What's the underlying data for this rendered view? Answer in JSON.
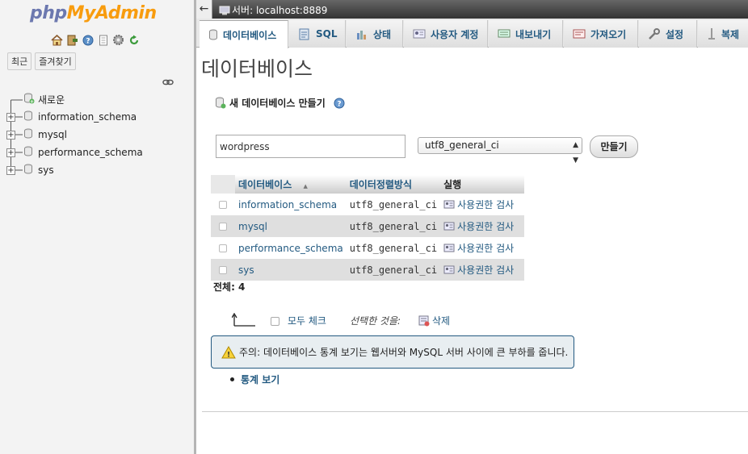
{
  "sidebar": {
    "logo_php": "php",
    "logo_myadmin": "MyAdmin",
    "icons": [
      "home-icon",
      "logout-icon",
      "help-icon",
      "docs-icon",
      "settings-icon",
      "reload-icon"
    ],
    "buttons": {
      "recent": "최근",
      "favorites": "즐겨찾기"
    },
    "tree": {
      "new_label": "새로운",
      "databases": [
        "information_schema",
        "mysql",
        "performance_schema",
        "sys"
      ]
    }
  },
  "topbar": {
    "back": "←",
    "server": "서버: localhost:8889"
  },
  "tabs": [
    {
      "label": "데이터베이스",
      "icon": "database-icon",
      "active": true
    },
    {
      "label": "SQL",
      "icon": "sql-icon"
    },
    {
      "label": "상태",
      "icon": "status-icon"
    },
    {
      "label": "사용자 계정",
      "icon": "users-icon"
    },
    {
      "label": "내보내기",
      "icon": "export-icon"
    },
    {
      "label": "가져오기",
      "icon": "import-icon"
    },
    {
      "label": "설정",
      "icon": "wrench-icon"
    },
    {
      "label": "복제",
      "icon": "replication-icon"
    }
  ],
  "main": {
    "title": "데이터베이스",
    "create": {
      "heading": "새 데이터베이스 만들기",
      "db_name_value": "wordpress",
      "collation_value": "utf8_general_ci",
      "button": "만들기"
    },
    "table": {
      "headers": {
        "database": "데이터베이스",
        "sort_arrow": "▲",
        "collation": "데이터정렬방식",
        "action": "실행"
      },
      "rows": [
        {
          "name": "information_schema",
          "collation": "utf8_general_ci",
          "action": "사용권한 검사"
        },
        {
          "name": "mysql",
          "collation": "utf8_general_ci",
          "action": "사용권한 검사"
        },
        {
          "name": "performance_schema",
          "collation": "utf8_general_ci",
          "action": "사용권한 검사"
        },
        {
          "name": "sys",
          "collation": "utf8_general_ci",
          "action": "사용권한 검사"
        }
      ],
      "total": "전체: 4"
    },
    "bulk": {
      "check_all": "모두 체크",
      "with_selected": "선택한 것을:",
      "drop": "삭제"
    },
    "notice": "주의: 데이터베이스 통계 보기는 웹서버와 MySQL 서버 사이에 큰 부하를 줍니다.",
    "stats_link": "통계 보기"
  },
  "colors": {
    "link": "#235a81",
    "logo_php": "#6c78af",
    "logo_myadmin": "#f89c0e",
    "notice_border": "#235a81"
  }
}
